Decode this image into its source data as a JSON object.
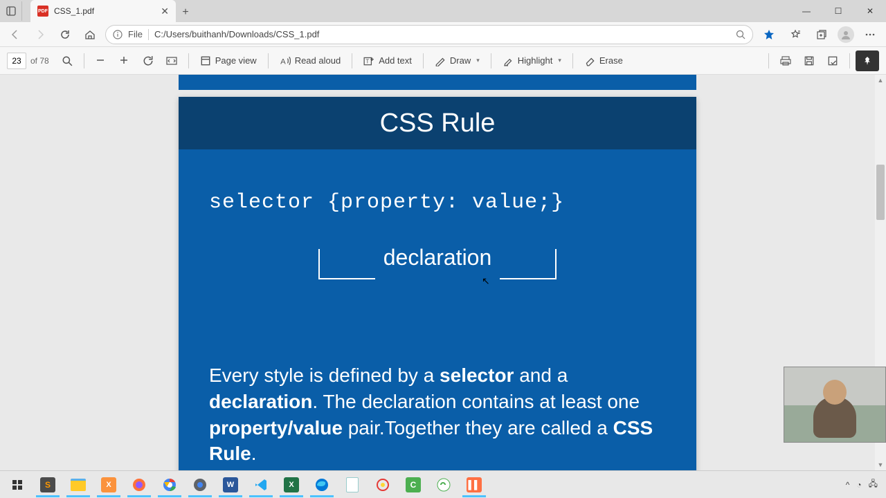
{
  "window": {
    "minimize": "—",
    "maximize": "☐",
    "close": "✕"
  },
  "tab": {
    "title": "CSS_1.pdf",
    "icon_label": "PDF"
  },
  "addr": {
    "file_label": "File",
    "url": "C:/Users/buithanh/Downloads/CSS_1.pdf"
  },
  "toolbar": {
    "page_current": "23",
    "page_total": "of 78",
    "page_view": "Page view",
    "read_aloud": "Read aloud",
    "add_text": "Add text",
    "draw": "Draw",
    "highlight": "Highlight",
    "erase": "Erase"
  },
  "slide": {
    "title": "CSS Rule",
    "code": "selector {property: value;}",
    "declaration_label": "declaration",
    "desc_p1a": "Every style is defined by a ",
    "desc_p1b": "selector",
    "desc_p1c": " and a ",
    "desc_p1d": "declaration",
    "desc_p1e": ". The declaration contains at least one ",
    "desc_p1f": "property/value",
    "desc_p1g": " pair.Together they are called a ",
    "desc_p1h": "CSS Rule",
    "desc_p1i": "."
  }
}
